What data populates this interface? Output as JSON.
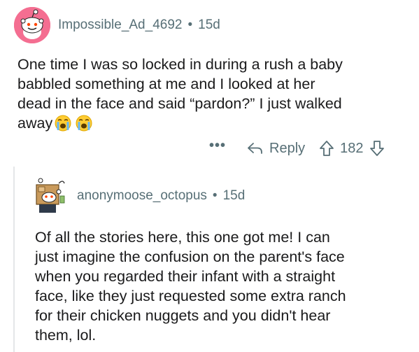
{
  "comment": {
    "username": "Impossible_Ad_4692",
    "separator": "•",
    "age": "15d",
    "text_lines": [
      "One time I was so locked in during a rush a baby",
      "babbled something at me and I looked at her",
      "dead in the face and said “pardon?” I just walked",
      "away"
    ],
    "emoji": [
      "loudly-crying-face",
      "loudly-crying-face"
    ],
    "actions": {
      "more_label": "•••",
      "reply_label": "Reply",
      "score": "182"
    }
  },
  "reply": {
    "username": "anonymoose_octopus",
    "separator": "•",
    "age": "15d",
    "text_lines": [
      "Of all the stories here, this one got me! I can",
      "just imagine the confusion on the parent's face",
      "when you regarded their infant with a straight",
      "face, like they just requested some extra ranch",
      "for their chicken nuggets and you didn't hear",
      "them, lol."
    ]
  },
  "colors": {
    "meta_text": "#576f76",
    "body_text": "#1a1a1b",
    "avatar_bg": "#ff6a8a",
    "thread_line": "#e4e6e8"
  }
}
